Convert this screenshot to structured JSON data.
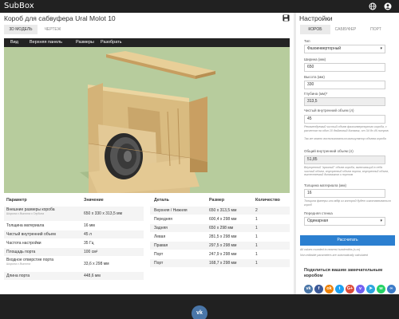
{
  "app": {
    "name": "SubBox"
  },
  "icons": {
    "language": "globe-icon",
    "account": "user-icon",
    "save": "floppy-icon",
    "select": "chevron-down-icon"
  },
  "page": {
    "title": "Короб для сабвуфера Ural Molot 10"
  },
  "tabs": [
    {
      "label": "3D МОДЕЛЬ",
      "active": true
    },
    {
      "label": "ЧЕРТЕЖ",
      "active": false
    }
  ],
  "viewer": {
    "menu": [
      "Вид",
      "Верхняя панель",
      "Размеры",
      "Разобрать"
    ]
  },
  "params_table": {
    "headers": [
      "Параметр",
      "Значение"
    ],
    "rows": [
      {
        "name": "Внешние размеры короба",
        "sub": "Ширина x Высота x Глубина",
        "value": "650 x 330 x 313,5 мм"
      },
      {
        "name": "Толщина материала",
        "sub": "",
        "value": "16 мм"
      },
      {
        "name": "Чистый внутренний объем",
        "sub": "",
        "value": "45 л"
      },
      {
        "name": "Частота настройки",
        "sub": "",
        "value": "35 Гц"
      },
      {
        "name": "Площадь порта",
        "sub": "",
        "value": "100 см²"
      },
      {
        "name": "Входное отверстие порта",
        "sub": "Ширина x Высота",
        "value": "33,6 x 298 мм"
      },
      {
        "name": "Длина порта",
        "sub": "",
        "value": "448,6 мм"
      }
    ]
  },
  "parts_table": {
    "headers": [
      "Деталь",
      "Размер",
      "Количество"
    ],
    "rows": [
      {
        "part": "Верхняя / Нижняя",
        "size": "650 x 313,5 мм",
        "qty": "2"
      },
      {
        "part": "Передняя",
        "size": "600,4 x 298 мм",
        "qty": "1"
      },
      {
        "part": "Задняя",
        "size": "650 x 298 мм",
        "qty": "1"
      },
      {
        "part": "Левая",
        "size": "281,5 x 298 мм",
        "qty": "1"
      },
      {
        "part": "Правая",
        "size": "297,5 x 298 мм",
        "qty": "1"
      },
      {
        "part": "Порт",
        "size": "247,9 x 298 мм",
        "qty": "1"
      },
      {
        "part": "Порт",
        "size": "168,7 x 298 мм",
        "qty": "1"
      }
    ]
  },
  "settings": {
    "title": "Настройки",
    "tabs": [
      {
        "label": "КОРОБ",
        "active": true
      },
      {
        "label": "САБВУФЕР",
        "active": false
      },
      {
        "label": "ПОРТ",
        "active": false
      }
    ],
    "type": {
      "label": "Тип",
      "value": "Фазоинверторный"
    },
    "width": {
      "label": "Ширина (мм)",
      "value": "650"
    },
    "height": {
      "label": "Высота (мм)",
      "value": "330"
    },
    "depth": {
      "label": "Глубина (мм)*",
      "value": "313,5"
    },
    "net_volume": {
      "label": "Чистый внутренний объем (л)",
      "value": "45",
      "hint1": "Рекомендуемый чистый объем фазоинверторного короба, с расчетом на один 10 дюймовый динамик, от 34 до 46 литров.",
      "hint2": "Так же можно воспользоваться калькулятор объема короба"
    },
    "gross_volume": {
      "label": "Общий внутренний объем (л)",
      "value": "51,85",
      "hint": "Внутренний \"грязный\" объем короба, включающий в себя чистый объем, внутренний объем порта, внутренний объем, вытесняемый динамиком и портом"
    },
    "thickness": {
      "label": "Толщина материала (мм)",
      "value": "16",
      "hint": "Толщина фанеры или мдф из которой будет изготавливаться короб"
    },
    "front_wall": {
      "label": "Передняя стенка",
      "value": "Одинарная"
    },
    "calc_button": "Рассчитать",
    "notes": [
      "All values rounded to nearest hundredths (x,xx)",
      "Non-editable parameters are automatically calculated"
    ],
    "share_title": "Поделиться вашим замечательным коробом",
    "social": [
      {
        "name": "vk",
        "glyph": "vk",
        "color": "#4a76a8"
      },
      {
        "name": "facebook",
        "glyph": "f",
        "color": "#3b5998"
      },
      {
        "name": "odnoklassniki",
        "glyph": "ok",
        "color": "#ee8208"
      },
      {
        "name": "twitter",
        "glyph": "t",
        "color": "#1da1f2"
      },
      {
        "name": "google-plus",
        "glyph": "G+",
        "color": "#dd4b39"
      },
      {
        "name": "viber",
        "glyph": "v",
        "color": "#7360f2"
      },
      {
        "name": "telegram",
        "glyph": "➤",
        "color": "#2ca5e0"
      },
      {
        "name": "whatsapp",
        "glyph": "w",
        "color": "#25d366"
      },
      {
        "name": "link",
        "glyph": "∞",
        "color": "#3d7cc9"
      }
    ]
  },
  "footer": {
    "vk_glyph": "vk"
  }
}
